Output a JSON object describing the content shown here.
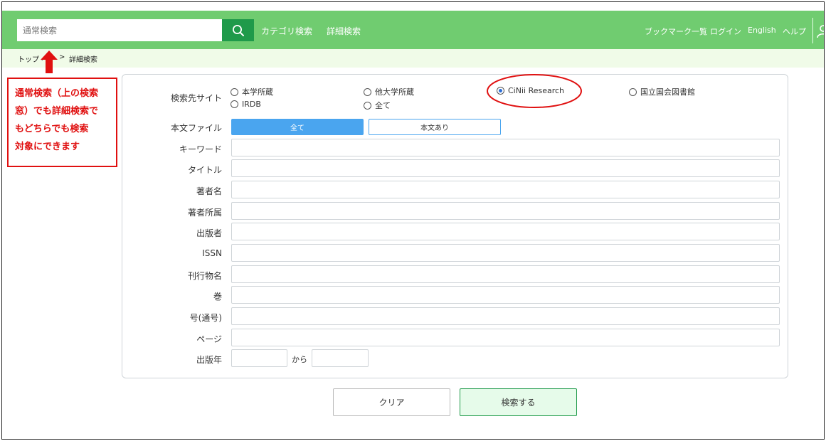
{
  "header": {
    "search_placeholder": "通常検索",
    "category_search": "カテゴリ検索",
    "advanced_search": "詳細検索",
    "bookmarks": "ブックマーク一覧",
    "login": "ログイン",
    "english": "English",
    "help": "ヘルプ"
  },
  "breadcrumb": {
    "top": "トップ",
    "hidden": "ペー",
    "sep": ">",
    "current": "詳細検索"
  },
  "annotation": {
    "lines": [
      "通常検索（上の検索",
      "窓）でも詳細検索で",
      "もどちらでも検索",
      "対象にできます"
    ]
  },
  "form": {
    "site_label": "検索先サイト",
    "site_options": [
      {
        "label": "本学所蔵",
        "selected": false
      },
      {
        "label": "他大学所蔵",
        "selected": false
      },
      {
        "label": "CiNii Research",
        "selected": true
      },
      {
        "label": "国立国会図書館",
        "selected": false
      },
      {
        "label": "IRDB",
        "selected": false
      },
      {
        "label": "全て",
        "selected": false
      }
    ],
    "fulltext_label": "本文ファイル",
    "fulltext_all": "全て",
    "fulltext_has": "本文あり",
    "fields": [
      "キーワード",
      "タイトル",
      "著者名",
      "著者所属",
      "出版者",
      "ISSN",
      "刊行物名",
      "巻",
      "号(通号)",
      "ページ"
    ],
    "year_label": "出版年",
    "year_sep": "から"
  },
  "buttons": {
    "clear": "クリア",
    "search": "検索する"
  },
  "colors": {
    "header_green": "#70cc70",
    "search_button": "#1f9a4a",
    "segment_blue": "#4aa5ef",
    "annotation_red": "#e01010"
  }
}
